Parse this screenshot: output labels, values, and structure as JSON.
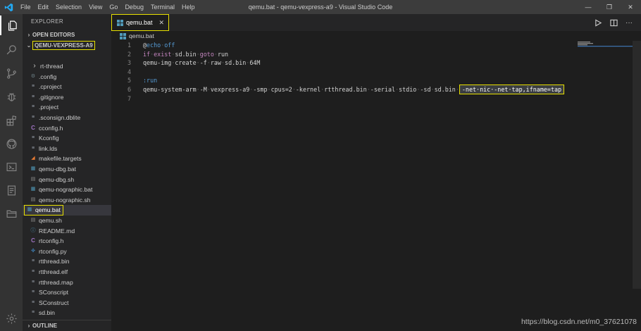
{
  "titlebar": {
    "menu": [
      "File",
      "Edit",
      "Selection",
      "View",
      "Go",
      "Debug",
      "Terminal",
      "Help"
    ],
    "title": "qemu.bat - qemu-vexpress-a9 - Visual Studio Code",
    "controls": {
      "minimize": "—",
      "restore": "❐",
      "close": "✕"
    }
  },
  "sidebar": {
    "title": "EXPLORER",
    "open_editors": "OPEN EDITORS",
    "project": "QEMU-VEXPRESS-A9",
    "outline": "OUTLINE",
    "files": [
      {
        "name": "rt-thread",
        "icon": "folder-chevron-icon",
        "glyph": "›",
        "color": "#cccccc"
      },
      {
        "name": ".config",
        "icon": "gear-icon",
        "glyph": "⚙",
        "color": "#6d8086"
      },
      {
        "name": ".cproject",
        "icon": "file-lines-icon",
        "glyph": "≡",
        "color": "#9ca3af"
      },
      {
        "name": ".gitignore",
        "icon": "file-lines-icon",
        "glyph": "≡",
        "color": "#9ca3af"
      },
      {
        "name": ".project",
        "icon": "file-lines-icon",
        "glyph": "≡",
        "color": "#9ca3af"
      },
      {
        "name": ".sconsign.dblite",
        "icon": "file-lines-icon",
        "glyph": "≡",
        "color": "#9ca3af"
      },
      {
        "name": "cconfig.h",
        "icon": "c-file-icon",
        "glyph": "C",
        "color": "#a074c4"
      },
      {
        "name": "Kconfig",
        "icon": "file-lines-icon",
        "glyph": "≡",
        "color": "#9ca3af"
      },
      {
        "name": "link.lds",
        "icon": "file-lines-icon",
        "glyph": "≡",
        "color": "#9ca3af"
      },
      {
        "name": "makefile.targets",
        "icon": "rss-icon",
        "glyph": "◢",
        "color": "#e37933"
      },
      {
        "name": "qemu-dbg.bat",
        "icon": "windows-icon",
        "glyph": "▦",
        "color": "#519aba"
      },
      {
        "name": "qemu-dbg.sh",
        "icon": "terminal-file-icon",
        "glyph": "▤",
        "color": "#8a8a8a"
      },
      {
        "name": "qemu-nographic.bat",
        "icon": "windows-icon",
        "glyph": "▦",
        "color": "#519aba"
      },
      {
        "name": "qemu-nographic.sh",
        "icon": "terminal-file-icon",
        "glyph": "▤",
        "color": "#8a8a8a"
      },
      {
        "name": "qemu.bat",
        "icon": "windows-icon",
        "glyph": "▦",
        "color": "#519aba",
        "selected": true
      },
      {
        "name": "qemu.sh",
        "icon": "terminal-file-icon",
        "glyph": "▤",
        "color": "#8a8a8a"
      },
      {
        "name": "README.md",
        "icon": "info-icon",
        "glyph": "ⓘ",
        "color": "#519aba"
      },
      {
        "name": "rtconfig.h",
        "icon": "c-file-icon",
        "glyph": "C",
        "color": "#a074c4"
      },
      {
        "name": "rtconfig.py",
        "icon": "python-icon",
        "glyph": "✤",
        "color": "#3c78aa"
      },
      {
        "name": "rtthread.bin",
        "icon": "file-lines-icon",
        "glyph": "≡",
        "color": "#9ca3af"
      },
      {
        "name": "rtthread.elf",
        "icon": "file-lines-icon",
        "glyph": "≡",
        "color": "#9ca3af"
      },
      {
        "name": "rtthread.map",
        "icon": "file-lines-icon",
        "glyph": "≡",
        "color": "#9ca3af"
      },
      {
        "name": "SConscript",
        "icon": "file-lines-icon",
        "glyph": "≡",
        "color": "#9ca3af"
      },
      {
        "name": "SConstruct",
        "icon": "file-lines-icon",
        "glyph": "≡",
        "color": "#9ca3af"
      },
      {
        "name": "sd.bin",
        "icon": "file-lines-icon",
        "glyph": "≡",
        "color": "#9ca3af"
      }
    ]
  },
  "editor": {
    "tab": {
      "label": "qemu.bat",
      "close": "✕"
    },
    "breadcrumb": "qemu.bat",
    "lines": [
      {
        "n": "1",
        "parts": [
          {
            "c": "at",
            "t": "@"
          },
          {
            "c": "echo",
            "t": "echo"
          },
          {
            "c": "dot",
            "t": "·"
          },
          {
            "c": "echo",
            "t": "off"
          }
        ]
      },
      {
        "n": "2",
        "parts": [
          {
            "c": "kw",
            "t": "if"
          },
          {
            "c": "dot",
            "t": "·"
          },
          {
            "c": "kw",
            "t": "exist"
          },
          {
            "c": "dot",
            "t": "·"
          },
          {
            "c": "",
            "t": "sd.bin"
          },
          {
            "c": "dot",
            "t": "·"
          },
          {
            "c": "kw",
            "t": "goto"
          },
          {
            "c": "dot",
            "t": "·"
          },
          {
            "c": "",
            "t": "run"
          }
        ]
      },
      {
        "n": "3",
        "parts": [
          {
            "c": "",
            "t": "qemu-img"
          },
          {
            "c": "dot",
            "t": "·"
          },
          {
            "c": "",
            "t": "create"
          },
          {
            "c": "dot",
            "t": "·"
          },
          {
            "c": "",
            "t": "-f"
          },
          {
            "c": "dot",
            "t": "·"
          },
          {
            "c": "",
            "t": "raw"
          },
          {
            "c": "dot",
            "t": "·"
          },
          {
            "c": "",
            "t": "sd.bin"
          },
          {
            "c": "dot",
            "t": "·"
          },
          {
            "c": "",
            "t": "64M"
          }
        ]
      },
      {
        "n": "4",
        "parts": []
      },
      {
        "n": "5",
        "parts": [
          {
            "c": "lbl",
            "t": ":run"
          }
        ]
      },
      {
        "n": "6",
        "parts": [
          {
            "c": "",
            "t": "qemu-system-arm"
          },
          {
            "c": "dot",
            "t": "·"
          },
          {
            "c": "",
            "t": "-M"
          },
          {
            "c": "dot",
            "t": "·"
          },
          {
            "c": "",
            "t": "vexpress-a9"
          },
          {
            "c": "dot",
            "t": "·"
          },
          {
            "c": "",
            "t": "-smp"
          },
          {
            "c": "dot",
            "t": "·"
          },
          {
            "c": "",
            "t": "cpus=2"
          },
          {
            "c": "dot",
            "t": "·"
          },
          {
            "c": "",
            "t": "-kernel"
          },
          {
            "c": "dot",
            "t": "·"
          },
          {
            "c": "",
            "t": "rtthread.bin"
          },
          {
            "c": "dot",
            "t": "·"
          },
          {
            "c": "",
            "t": "-serial"
          },
          {
            "c": "dot",
            "t": "·"
          },
          {
            "c": "",
            "t": "stdio"
          },
          {
            "c": "dot",
            "t": "·"
          },
          {
            "c": "",
            "t": "-sd"
          },
          {
            "c": "dot",
            "t": "·"
          },
          {
            "c": "",
            "t": "sd.bin"
          },
          {
            "c": "dot",
            "t": "·"
          },
          {
            "c": "hl",
            "t": "-net·nic·-net·tap,ifname=tap"
          }
        ]
      },
      {
        "n": "7",
        "parts": []
      }
    ]
  },
  "watermark": "https://blog.csdn.net/m0_37621078",
  "colors": {
    "highlight": "#e8e000",
    "accent": "#007acc"
  }
}
